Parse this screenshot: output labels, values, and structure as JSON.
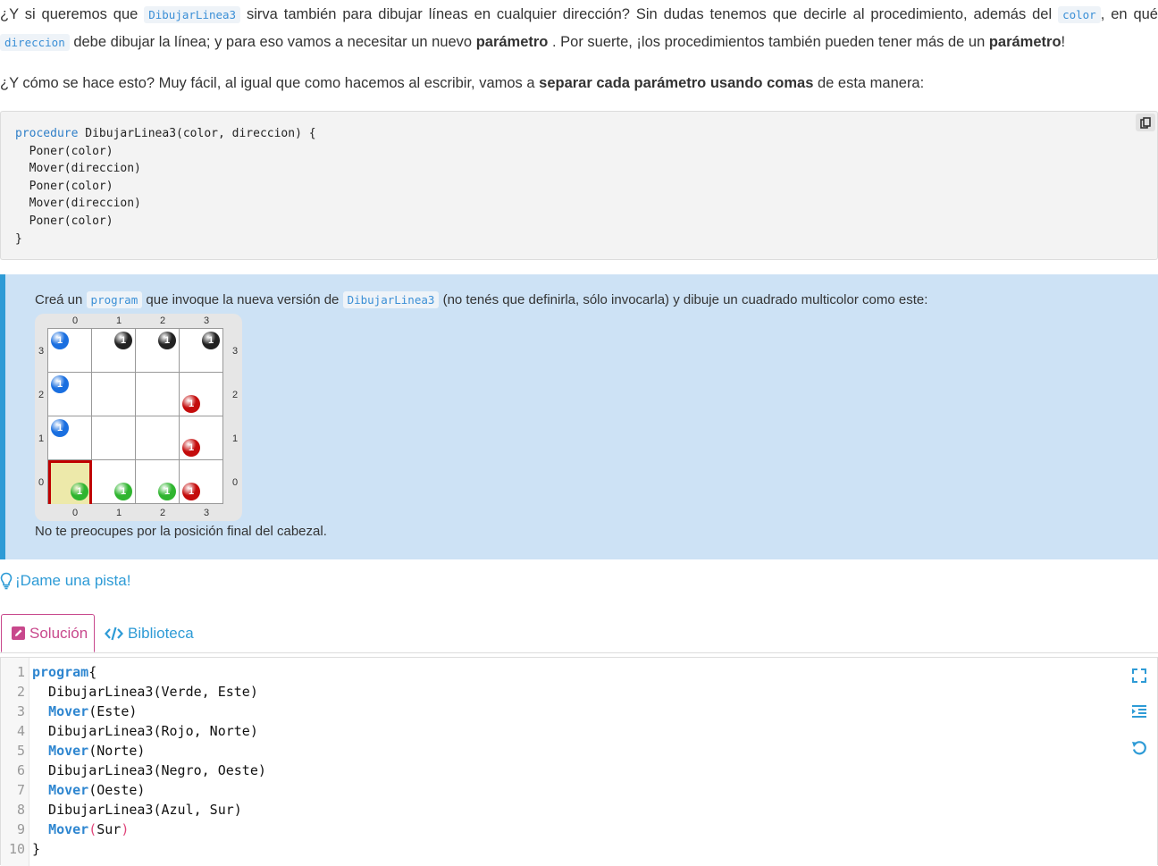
{
  "intro": {
    "p1_a": "¿Y si queremos que ",
    "p1_code1": "DibujarLinea3",
    "p1_b": " sirva también para dibujar líneas en cualquier dirección? Sin dudas tenemos que decirle al procedimiento, además del ",
    "p1_code2": "color",
    "p1_c": ", en qué ",
    "p1_code3": "direccion",
    "p1_d": " debe dibujar la línea; y para eso vamos a necesitar un nuevo ",
    "p1_bold1": "parámetro",
    "p1_e": " . Por suerte, ¡los procedimientos también pueden tener más de un ",
    "p1_bold2": "parámetro",
    "p1_f": "!",
    "p2_a": "¿Y cómo se hace esto? Muy fácil, al igual que como hacemos al escribir, vamos a ",
    "p2_bold": "separar cada parámetro usando comas",
    "p2_b": " de esta manera:"
  },
  "snippet": {
    "keyword": "procedure",
    "header": " DibujarLinea3(color, direccion) {",
    "body": [
      "  Poner(color)",
      "  Mover(direccion)",
      "  Poner(color)",
      "  Mover(direccion)",
      "  Poner(color)"
    ],
    "close": "}",
    "copy_icon": "copy-icon"
  },
  "task": {
    "t_a": "Creá un ",
    "t_code1": "program",
    "t_b": " que invoque la nueva versión de ",
    "t_code2": "DibujarLinea3",
    "t_c": " (no tenés que definirla, sólo invocarla) y dibuje un cuadrado multicolor como este:",
    "footer": "No te preocupes por la posición final del cabezal."
  },
  "board": {
    "size": 4,
    "col_labels": [
      "0",
      "1",
      "2",
      "3"
    ],
    "row_labels": [
      "3",
      "2",
      "1",
      "0"
    ],
    "head": {
      "x": 0,
      "y": 0
    },
    "colors": {
      "blue": "#1a6fe0",
      "black": "#222222",
      "red": "#c40c0c",
      "green": "#2fb52f"
    },
    "balls": [
      {
        "x": 0,
        "y": 3,
        "color": "blue",
        "count": "1"
      },
      {
        "x": 1,
        "y": 3,
        "color": "black",
        "count": "1"
      },
      {
        "x": 2,
        "y": 3,
        "color": "black",
        "count": "1"
      },
      {
        "x": 3,
        "y": 3,
        "color": "black",
        "count": "1"
      },
      {
        "x": 0,
        "y": 2,
        "color": "blue",
        "count": "1"
      },
      {
        "x": 3,
        "y": 2,
        "color": "red",
        "count": "1"
      },
      {
        "x": 0,
        "y": 1,
        "color": "blue",
        "count": "1"
      },
      {
        "x": 3,
        "y": 1,
        "color": "red",
        "count": "1"
      },
      {
        "x": 0,
        "y": 0,
        "color": "green",
        "count": "1"
      },
      {
        "x": 1,
        "y": 0,
        "color": "green",
        "count": "1"
      },
      {
        "x": 2,
        "y": 0,
        "color": "green",
        "count": "1"
      },
      {
        "x": 3,
        "y": 0,
        "color": "red",
        "count": "1"
      }
    ]
  },
  "hint": {
    "label": "¡Dame una pista!",
    "icon": "lightbulb-icon"
  },
  "tabs": {
    "solution": {
      "label": "Solución",
      "icon": "edit-icon"
    },
    "library": {
      "label": "Biblioteca",
      "icon": "code-icon"
    }
  },
  "editor": {
    "lines": [
      {
        "no": "1",
        "parts": [
          {
            "t": "program",
            "k": "kw"
          },
          {
            "t": "{"
          }
        ]
      },
      {
        "no": "2",
        "parts": [
          {
            "t": "  DibujarLinea3(Verde, Este)"
          }
        ]
      },
      {
        "no": "3",
        "parts": [
          {
            "t": "  "
          },
          {
            "t": "Mover",
            "k": "kw"
          },
          {
            "t": "(Este)"
          }
        ]
      },
      {
        "no": "4",
        "parts": [
          {
            "t": "  DibujarLinea3(Rojo, Norte)"
          }
        ]
      },
      {
        "no": "5",
        "parts": [
          {
            "t": "  "
          },
          {
            "t": "Mover",
            "k": "kw"
          },
          {
            "t": "(Norte)"
          }
        ]
      },
      {
        "no": "6",
        "parts": [
          {
            "t": "  DibujarLinea3(Negro, Oeste)"
          }
        ]
      },
      {
        "no": "7",
        "parts": [
          {
            "t": "  "
          },
          {
            "t": "Mover",
            "k": "kw"
          },
          {
            "t": "(Oeste)"
          }
        ]
      },
      {
        "no": "8",
        "parts": [
          {
            "t": "  DibujarLinea3(Azul, Sur)"
          }
        ]
      },
      {
        "no": "9",
        "parts": [
          {
            "t": "  "
          },
          {
            "t": "Mover",
            "k": "kw"
          },
          {
            "t": "(",
            "k": "paren-pink"
          },
          {
            "t": "Sur"
          },
          {
            "t": ")",
            "k": "paren-pink"
          }
        ]
      },
      {
        "no": "10",
        "parts": [
          {
            "t": "}"
          }
        ]
      }
    ],
    "tools": [
      "fullscreen-icon",
      "indent-icon",
      "reset-icon"
    ]
  }
}
